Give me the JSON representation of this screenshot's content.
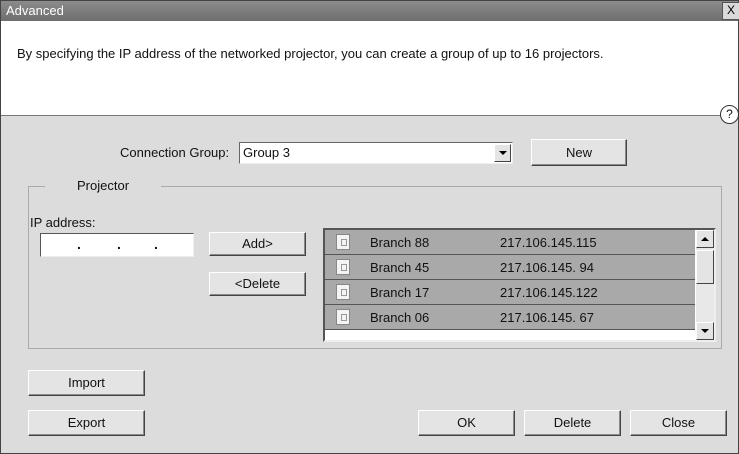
{
  "window": {
    "title": "Advanced",
    "close_label": "X"
  },
  "header": {
    "description": "By specifying the IP address of the networked projector, you can create a group of up to 16 projectors.",
    "help_label": "?"
  },
  "connection_group": {
    "label": "Connection Group:",
    "selected": "Group 3",
    "new_label": "New"
  },
  "projector": {
    "group_title": "Projector",
    "ip_label": "IP address:",
    "ip_value_dots": [
      ".",
      ".",
      "."
    ],
    "add_label": "Add>",
    "delete_label": "<Delete",
    "list": [
      {
        "name": "Branch 88",
        "ip": "217.106.145.115"
      },
      {
        "name": "Branch 45",
        "ip": "217.106.145. 94"
      },
      {
        "name": "Branch 17",
        "ip": "217.106.145.122"
      },
      {
        "name": "Branch 06",
        "ip": "217.106.145. 67"
      }
    ]
  },
  "footer": {
    "import_label": "Import",
    "export_label": "Export",
    "ok_label": "OK",
    "delete_label": "Delete",
    "close_label": "Close"
  }
}
